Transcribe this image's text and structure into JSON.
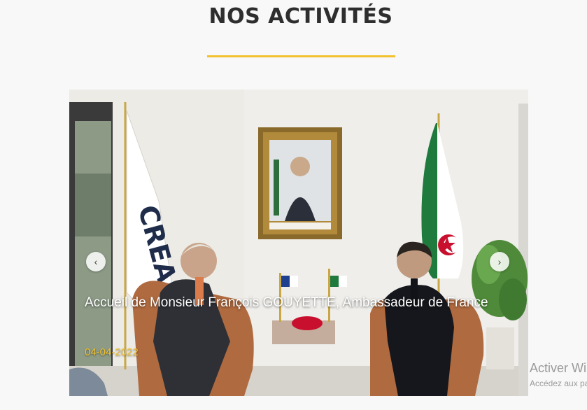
{
  "section": {
    "title": "NOS ACTIVITÉS"
  },
  "slider": {
    "caption": "Accueil de Monsieur François GOUYETTE, Ambassadeur de France",
    "date": "04-04-2022",
    "prev_icon": "chevron-left-icon",
    "next_icon": "chevron-right-icon",
    "prev_glyph": "‹",
    "next_glyph": "›"
  },
  "watermark": {
    "title": "Activer Windows",
    "subtitle": "Accédez aux paramètres"
  },
  "colors": {
    "accent": "#f2c12e",
    "title_text": "#2e2e2e",
    "background": "#f8f8f8"
  }
}
